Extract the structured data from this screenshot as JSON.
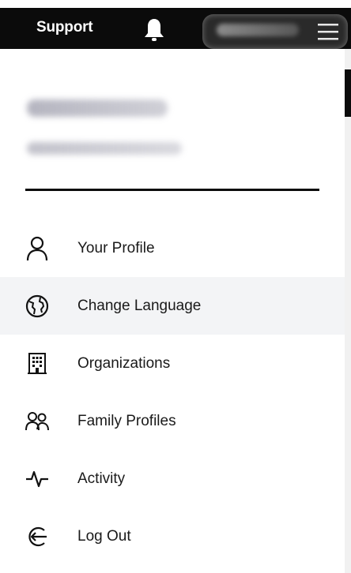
{
  "header": {
    "support_label": "Support",
    "bell_icon": "bell-icon",
    "menu_icon": "hamburger-icon"
  },
  "menu": {
    "items": [
      {
        "label": "Your Profile",
        "icon": "person-icon"
      },
      {
        "label": "Change Language",
        "icon": "globe-icon",
        "active": true
      },
      {
        "label": "Organizations",
        "icon": "building-icon"
      },
      {
        "label": "Family Profiles",
        "icon": "people-icon"
      },
      {
        "label": "Activity",
        "icon": "activity-icon"
      },
      {
        "label": "Log Out",
        "icon": "logout-icon"
      }
    ]
  },
  "colors": {
    "header_bg": "#0b0b0b",
    "active_bg": "#f3f4f6",
    "text": "#1a1a1a",
    "icon": "#111111"
  }
}
